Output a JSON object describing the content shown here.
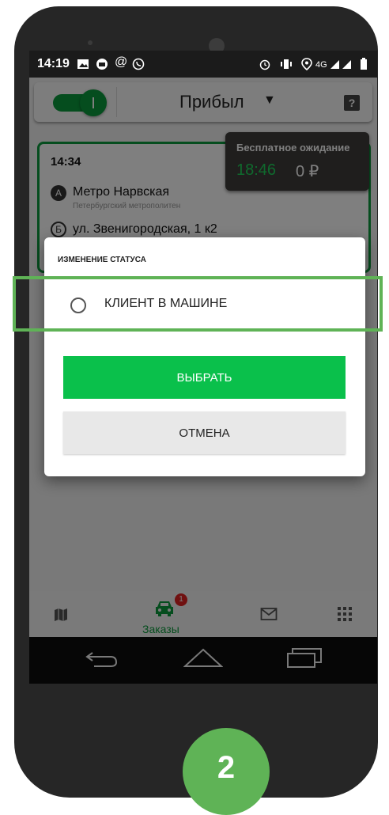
{
  "status_bar": {
    "time": "14:19",
    "left_icons": [
      "image-icon",
      "car-icon",
      "at-icon",
      "viber-icon"
    ],
    "right_icons": [
      "alarm-icon",
      "vibrate-icon",
      "location-icon",
      "signal-4g-icon",
      "battery-icon"
    ],
    "network": "4G"
  },
  "app_bar": {
    "online_toggle": "on",
    "status_title": "Прибыл",
    "help_label": "?"
  },
  "order_card": {
    "time": "14:34",
    "point_a_marker": "А",
    "point_a_address": "Метро Нарвская",
    "point_a_sub": "Петербургский метрополитен",
    "point_b_marker": "Б",
    "point_b_address": "ул. Звенигородская, 1 к2"
  },
  "waiting": {
    "label": "Бесплатное ожидание",
    "timer": "18:46",
    "cost": "0 ₽"
  },
  "dialog": {
    "title": "ИЗМЕНЕНИЕ СТАТУСА",
    "option_label": "КЛИЕНТ В МАШИНЕ",
    "choose_button": "ВЫБРАТЬ",
    "cancel_button": "ОТМЕНА"
  },
  "bottom_nav": {
    "orders_label": "Заказы",
    "orders_badge": "1",
    "active_tab": "orders"
  },
  "step_badge": "2",
  "colors": {
    "accent_green": "#0ac04b",
    "dark_green": "#0a9b3c",
    "timer_green": "#1fd35a",
    "highlight_green": "#5fb356",
    "badge_red": "#e02020"
  }
}
